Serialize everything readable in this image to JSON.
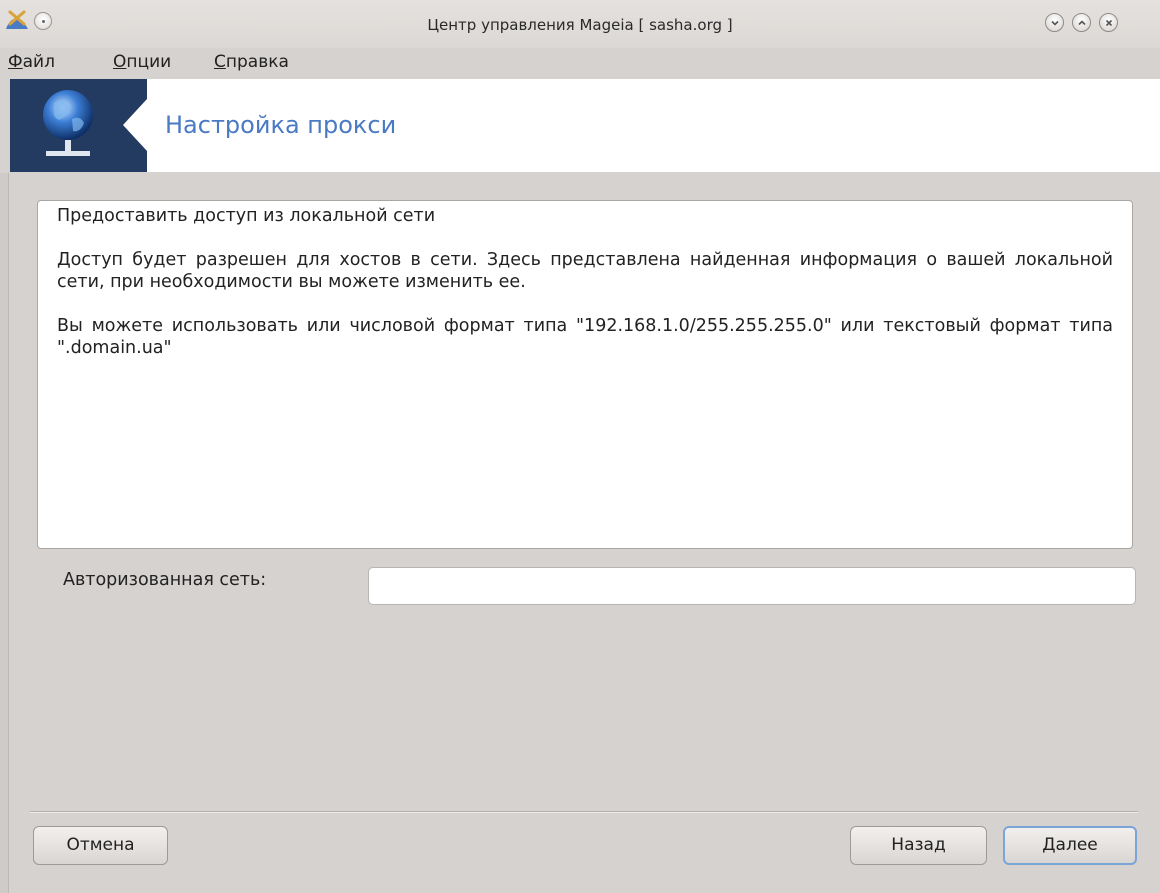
{
  "window": {
    "title": "Центр управления Mageia  [ sasha.org ]",
    "controls": [
      "minimize-icon",
      "maximize-icon",
      "close-icon"
    ]
  },
  "menubar": {
    "items": [
      {
        "mnemonic": "Ф",
        "rest": "айл"
      },
      {
        "mnemonic": "О",
        "rest": "пции"
      },
      {
        "mnemonic": "С",
        "rest": "правка"
      }
    ]
  },
  "banner": {
    "title": "Настройка прокси",
    "icon": "network-globe-icon",
    "colors": {
      "panel": "#233b60",
      "title": "#4a7ac3"
    }
  },
  "info": {
    "heading": "Предоставить доступ из локальной сети",
    "paragraph1": "Доступ будет разрешен для хостов в сети. Здесь представлена найденная информация о вашей локальной сети, при необходимости вы можете изменить ее.",
    "paragraph2": "Вы можете использовать или числовой формат типа \"192.168.1.0/255.255.255.0\" или текстовый формат типа \".domain.ua\""
  },
  "form": {
    "authorized_network_label": "Авторизованная сеть:",
    "authorized_network_value": ""
  },
  "buttons": {
    "cancel": "Отмена",
    "back": "Назад",
    "next": "Далее"
  }
}
